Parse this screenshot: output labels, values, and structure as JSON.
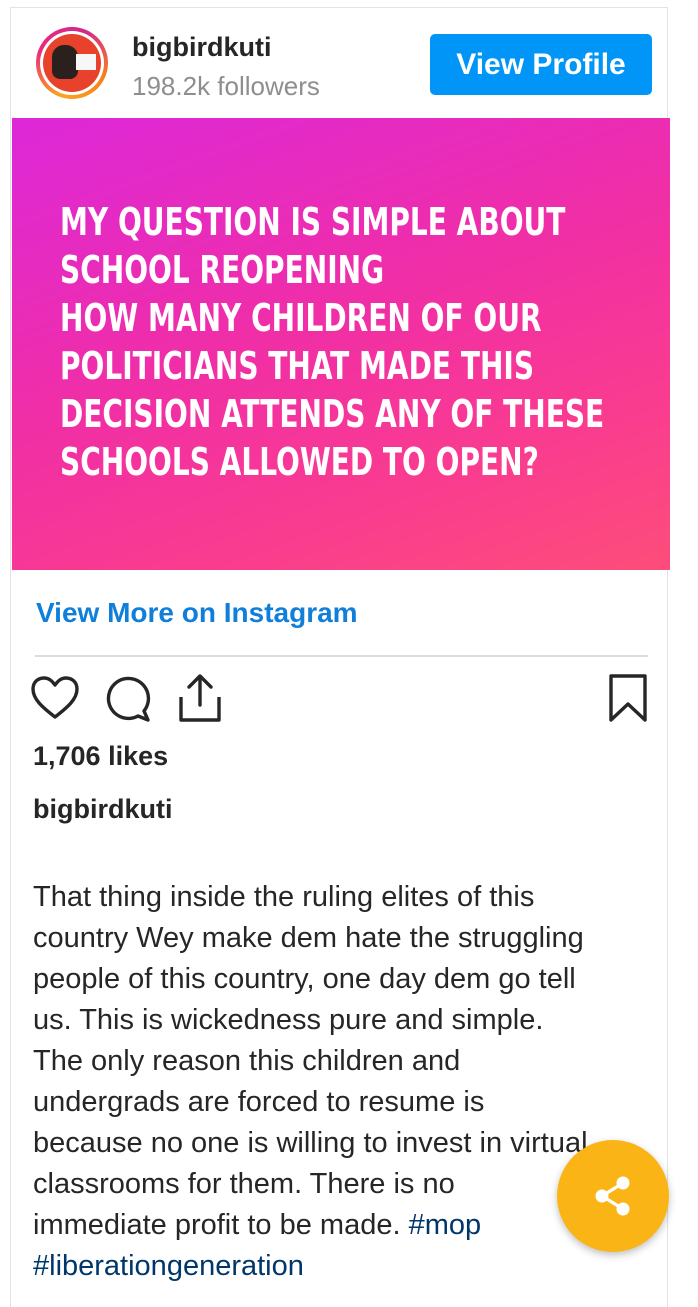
{
  "header": {
    "username": "bigbirdkuti",
    "followers": "198.2k followers",
    "view_profile_label": "View Profile"
  },
  "post": {
    "image_text_lines": [
      "MY QUESTION IS SIMPLE ABOUT",
      "SCHOOL REOPENING",
      "HOW MANY CHILDREN OF OUR",
      "POLITICIANS THAT MADE THIS",
      "DECISION ATTENDS ANY OF THESE",
      "SCHOOLS ALLOWED TO OPEN?"
    ],
    "colors": {
      "gradient_start": "#dd28d9",
      "gradient_end": "#fd4d7a"
    }
  },
  "view_more_label": "View More on Instagram",
  "actions": {
    "like_icon": "heart-icon",
    "comment_icon": "comment-icon",
    "share_icon": "share-upload-icon",
    "save_icon": "bookmark-icon"
  },
  "likes": "1,706 likes",
  "caption": {
    "username": "bigbirdkuti",
    "lines": [
      "That thing inside the ruling elites of this",
      "country Wey make dem hate the struggling",
      "people of this country, one day dem go tell",
      "us. This is wickedness pure and simple.",
      "The only reason this children and",
      "undergrads are forced to resume is",
      "because no one is willing to invest in virtual",
      "classrooms for them. There is no",
      "immediate profit to be made."
    ],
    "hashtag_1": "#mop",
    "hashtag_2": "#liberationgeneration"
  },
  "fab": {
    "icon": "share-icon",
    "color": "#fbb416"
  },
  "colors": {
    "accent": "#0095f6",
    "link": "#0f7fd9",
    "hashtag": "#00376b"
  }
}
